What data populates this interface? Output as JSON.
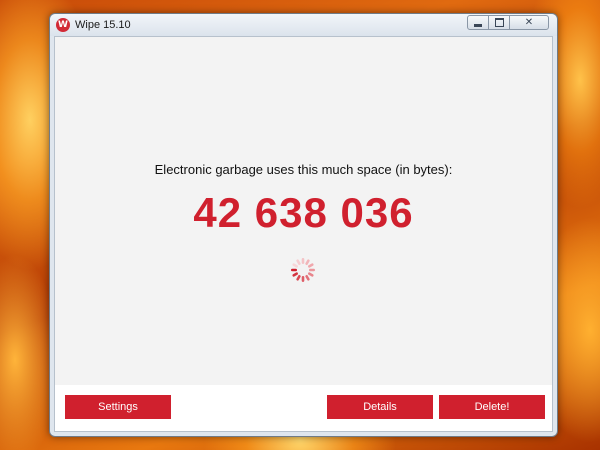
{
  "window": {
    "title": "Wipe 15.10",
    "app_icon_letter": "W"
  },
  "main": {
    "label": "Electronic garbage uses this much space (in bytes):",
    "garbage_bytes": "42 638 036"
  },
  "buttons": {
    "settings": "Settings",
    "details": "Details",
    "delete": "Delete!"
  },
  "colors": {
    "accent": "#d0202e",
    "window_bg": "#f3f3f3",
    "footer_bg": "#ffffff"
  },
  "icons": {
    "app": "wipe-logo-icon",
    "progress": "loading-spinner-icon",
    "minimize": "minimize-icon",
    "maximize": "maximize-icon",
    "close": "close-icon"
  }
}
